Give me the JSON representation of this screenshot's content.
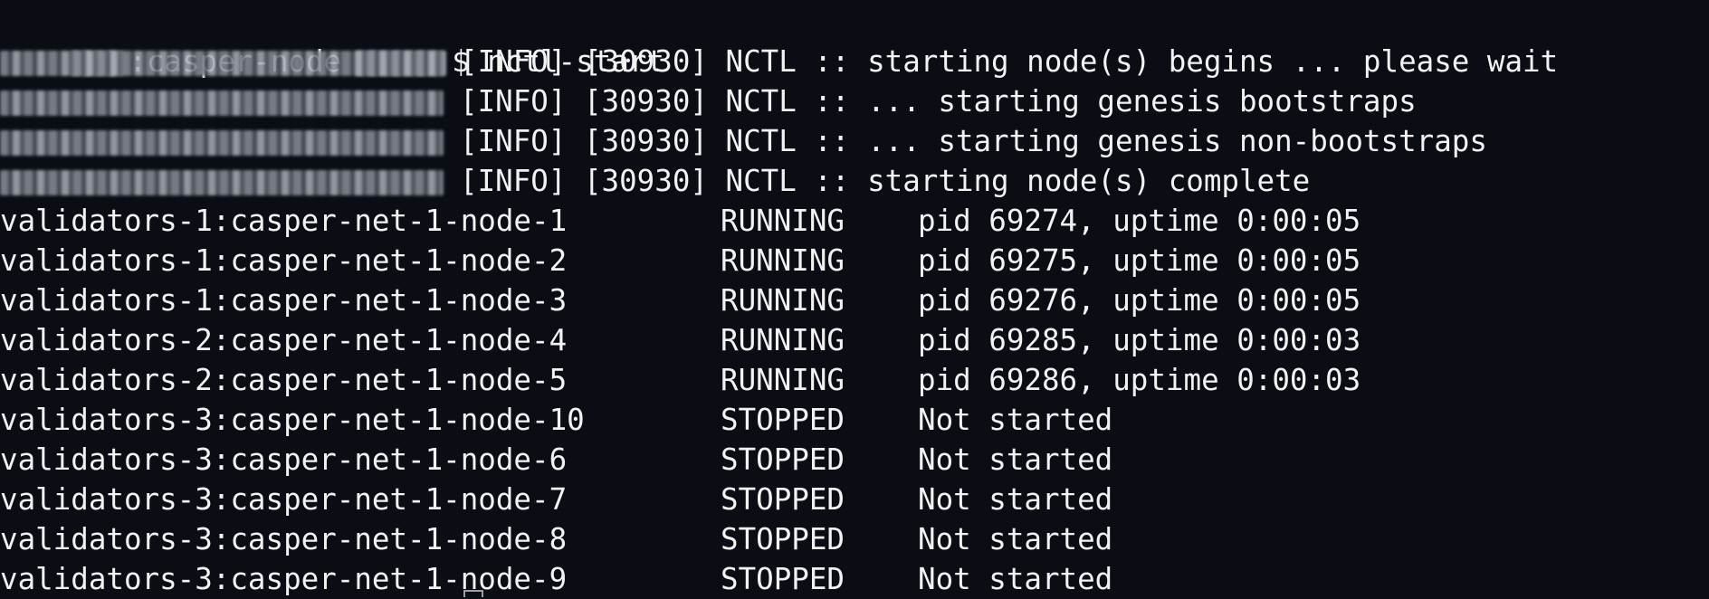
{
  "prompt": {
    "host": ":casper-node",
    "symbol": "$",
    "command": "nctl-start"
  },
  "log_lines": [
    {
      "level": "[INFO]",
      "pid": "[30930]",
      "message": "NCTL :: starting node(s) begins ... please wait"
    },
    {
      "level": "[INFO]",
      "pid": "[30930]",
      "message": "NCTL :: ... starting genesis bootstraps"
    },
    {
      "level": "[INFO]",
      "pid": "[30930]",
      "message": "NCTL :: ... starting genesis non-bootstraps"
    },
    {
      "level": "[INFO]",
      "pid": "[30930]",
      "message": "NCTL :: starting node(s) complete"
    }
  ],
  "nodes": [
    {
      "name": "validators-1:casper-net-1-node-1",
      "status": "RUNNING",
      "info": "pid 69274, uptime 0:00:05"
    },
    {
      "name": "validators-1:casper-net-1-node-2",
      "status": "RUNNING",
      "info": "pid 69275, uptime 0:00:05"
    },
    {
      "name": "validators-1:casper-net-1-node-3",
      "status": "RUNNING",
      "info": "pid 69276, uptime 0:00:05"
    },
    {
      "name": "validators-2:casper-net-1-node-4",
      "status": "RUNNING",
      "info": "pid 69285, uptime 0:00:03"
    },
    {
      "name": "validators-2:casper-net-1-node-5",
      "status": "RUNNING",
      "info": "pid 69286, uptime 0:00:03"
    },
    {
      "name": "validators-3:casper-net-1-node-10",
      "status": "STOPPED",
      "info": "Not started"
    },
    {
      "name": "validators-3:casper-net-1-node-6",
      "status": "STOPPED",
      "info": "Not started"
    },
    {
      "name": "validators-3:casper-net-1-node-7",
      "status": "STOPPED",
      "info": "Not started"
    },
    {
      "name": "validators-3:casper-net-1-node-8",
      "status": "STOPPED",
      "info": "Not started"
    },
    {
      "name": "validators-3:casper-net-1-node-9",
      "status": "STOPPED",
      "info": "Not started"
    }
  ],
  "colors": {
    "background": "#0a0d14",
    "text": "#f2f2f2"
  }
}
